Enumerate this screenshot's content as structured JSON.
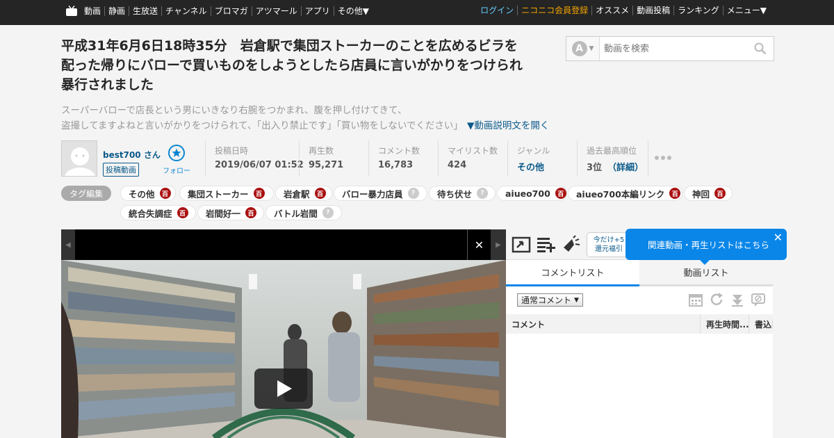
{
  "topbar": {
    "left_items": [
      "動画",
      "静画",
      "生放送",
      "チャンネル",
      "ブロマガ",
      "アツマール",
      "アプリ",
      "その他▼"
    ],
    "login": "ログイン",
    "premium": "ニコニコ会員登録",
    "right_items": [
      "オススメ",
      "動画投稿",
      "ランキング",
      "メニュー▼"
    ]
  },
  "video": {
    "title": "平成31年6月6日18時35分　岩倉駅で集団ストーカーのことを広めるビラを配った帰りにバローで買いものをしようとしたら店員に言いがかりをつけられ暴行されました",
    "desc_line1": "スーパーバローで店長という男にいきなり右腕をつかまれ、腹を押し付けてきて、",
    "desc_line2": "盗撮してますよねと言いがかりをつけられて、「出入り禁止です」「買い物をしないでください」",
    "desc_more": "▼動画説明文を開く"
  },
  "search": {
    "placeholder": "動画を検索",
    "service_badge": "A"
  },
  "owner": {
    "name": "best700 さん",
    "badge": "投稿動画",
    "follow_label": "フォロー"
  },
  "stats": {
    "posted_label": "投稿日時",
    "posted_value": "2019/06/07 01:52",
    "views_label": "再生数",
    "views_value": "95,271",
    "comments_label": "コメント数",
    "comments_value": "16,783",
    "mylist_label": "マイリスト数",
    "mylist_value": "424",
    "genre_label": "ジャンル",
    "genre_value": "その他",
    "rank_label": "過去最高順位",
    "rank_value": "3位",
    "rank_detail": "（詳細）"
  },
  "tags": {
    "edit_label": "タグ編集",
    "items": [
      {
        "label": "その他",
        "icon": "百"
      },
      {
        "label": "集団ストーカー",
        "icon": "百"
      },
      {
        "label": "岩倉駅",
        "icon": "百"
      },
      {
        "label": "バロー暴力店員",
        "icon": "?"
      },
      {
        "label": "待ち伏せ",
        "icon": "?"
      },
      {
        "label": "aiueo700",
        "icon": "百"
      },
      {
        "label": "aiueo700本編リンク",
        "icon": "百"
      },
      {
        "label": "神回",
        "icon": "百"
      },
      {
        "label": "統合失調症",
        "icon": "百"
      },
      {
        "label": "岩間好一",
        "icon": "百"
      },
      {
        "label": "バトル岩間",
        "icon": "?"
      }
    ]
  },
  "player": {
    "close": "✕"
  },
  "panel": {
    "promo_line1": "今だけ+5",
    "promo_line2": "還元福引",
    "tooltip": "関連動画・再生リストはこちら",
    "tooltip_close": "✕",
    "tab_comments": "コメントリスト",
    "tab_videos": "動画リスト",
    "select_value": "通常コメント",
    "col_comment": "コメント",
    "col_time": "再生時間...",
    "col_date": "書込日時"
  },
  "colors": {
    "topbar": "#252525",
    "link": "#0a5a8a",
    "accent_blue": "#0a86e8",
    "premium": "#f2a300",
    "tag_lock": "#aa1111"
  }
}
